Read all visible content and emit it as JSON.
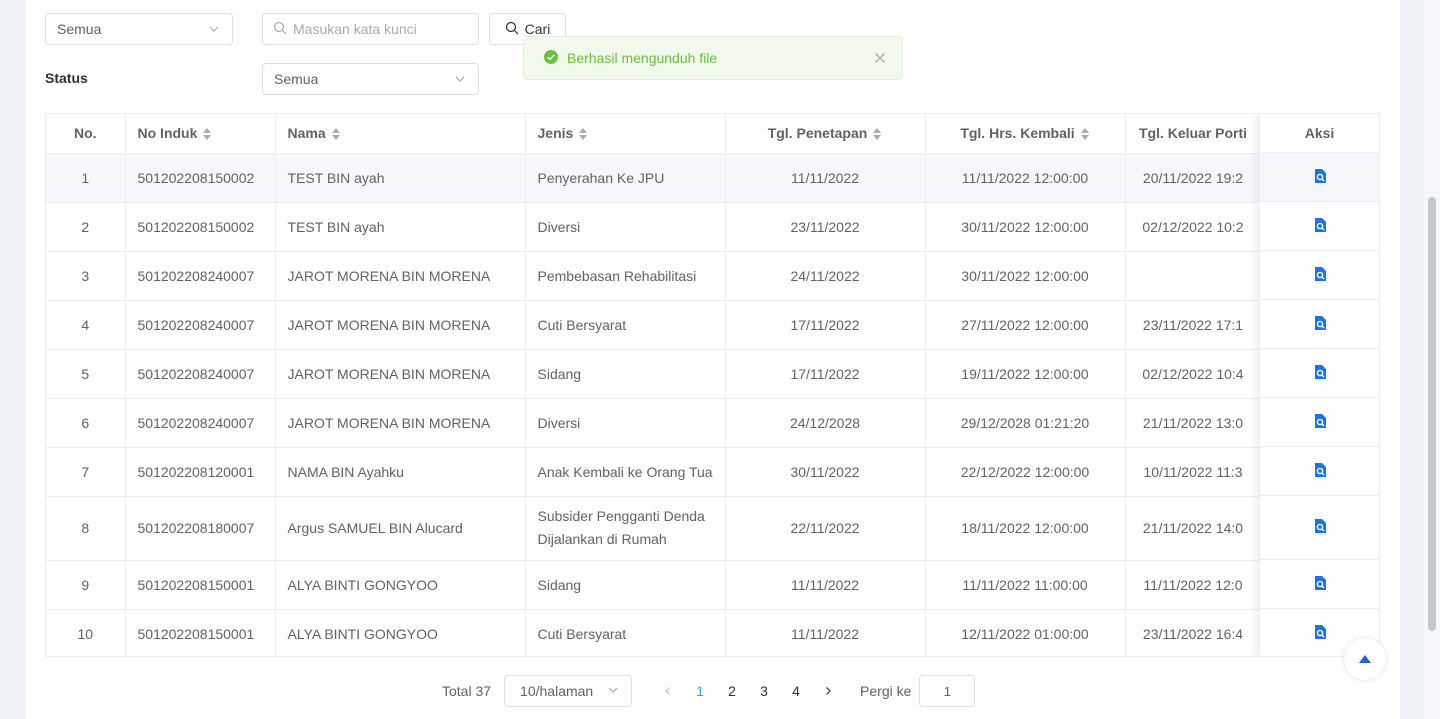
{
  "filters": {
    "category_select": "Semua",
    "search_placeholder": "Masukan kata kunci",
    "search_button": "Cari",
    "status_label": "Status",
    "status_select": "Semua"
  },
  "toast": {
    "message": "Berhasil mengunduh file"
  },
  "table": {
    "headers": {
      "no": "No.",
      "no_induk": "No Induk",
      "nama": "Nama",
      "jenis": "Jenis",
      "tgl_penetapan": "Tgl. Penetapan",
      "tgl_hrs_kembali": "Tgl. Hrs. Kembali",
      "tgl_keluar": "Tgl. Keluar Porti",
      "aksi": "Aksi"
    },
    "rows": [
      {
        "no": "1",
        "no_induk": "501202208150002",
        "nama": "TEST BIN ayah",
        "jenis": "Penyerahan Ke JPU",
        "tgl_penetapan": "11/11/2022",
        "tgl_hrs_kembali": "11/11/2022 12:00:00",
        "tgl_keluar": "20/11/2022 19:2"
      },
      {
        "no": "2",
        "no_induk": "501202208150002",
        "nama": "TEST BIN ayah",
        "jenis": "Diversi",
        "tgl_penetapan": "23/11/2022",
        "tgl_hrs_kembali": "30/11/2022 12:00:00",
        "tgl_keluar": "02/12/2022 10:2"
      },
      {
        "no": "3",
        "no_induk": "501202208240007",
        "nama": "JAROT MORENA BIN MORENA",
        "jenis": "Pembebasan Rehabilitasi",
        "tgl_penetapan": "24/11/2022",
        "tgl_hrs_kembali": "30/11/2022 12:00:00",
        "tgl_keluar": ""
      },
      {
        "no": "4",
        "no_induk": "501202208240007",
        "nama": "JAROT MORENA BIN MORENA",
        "jenis": "Cuti Bersyarat",
        "tgl_penetapan": "17/11/2022",
        "tgl_hrs_kembali": "27/11/2022 12:00:00",
        "tgl_keluar": "23/11/2022 17:1"
      },
      {
        "no": "5",
        "no_induk": "501202208240007",
        "nama": "JAROT MORENA BIN MORENA",
        "jenis": "Sidang",
        "tgl_penetapan": "17/11/2022",
        "tgl_hrs_kembali": "19/11/2022 12:00:00",
        "tgl_keluar": "02/12/2022 10:4"
      },
      {
        "no": "6",
        "no_induk": "501202208240007",
        "nama": "JAROT MORENA BIN MORENA",
        "jenis": "Diversi",
        "tgl_penetapan": "24/12/2028",
        "tgl_hrs_kembali": "29/12/2028 01:21:20",
        "tgl_keluar": "21/11/2022 13:0"
      },
      {
        "no": "7",
        "no_induk": "501202208120001",
        "nama": "NAMA BIN Ayahku",
        "jenis": "Anak Kembali ke Orang Tua",
        "tgl_penetapan": "30/11/2022",
        "tgl_hrs_kembali": "22/12/2022 12:00:00",
        "tgl_keluar": "10/11/2022 11:3"
      },
      {
        "no": "8",
        "no_induk": "501202208180007",
        "nama": "Argus SAMUEL BIN Alucard",
        "jenis": "Subsider Pengganti Denda Dijalankan di Rumah",
        "tgl_penetapan": "22/11/2022",
        "tgl_hrs_kembali": "18/11/2022 12:00:00",
        "tgl_keluar": "21/11/2022 14:0"
      },
      {
        "no": "9",
        "no_induk": "501202208150001",
        "nama": "ALYA BINTI GONGYOO",
        "jenis": "Sidang",
        "tgl_penetapan": "11/11/2022",
        "tgl_hrs_kembali": "11/11/2022 11:00:00",
        "tgl_keluar": "11/11/2022 12:0"
      },
      {
        "no": "10",
        "no_induk": "501202208150001",
        "nama": "ALYA BINTI GONGYOO",
        "jenis": "Cuti Bersyarat",
        "tgl_penetapan": "11/11/2022",
        "tgl_hrs_kembali": "12/11/2022 01:00:00",
        "tgl_keluar": "23/11/2022 16:4"
      }
    ],
    "action_icon": "view-document-icon"
  },
  "pagination": {
    "total": "Total 37",
    "page_size": "10/halaman",
    "pages": [
      "1",
      "2",
      "3",
      "4"
    ],
    "current_page": "1",
    "jump_label": "Pergi ke",
    "jump_value": "1"
  },
  "colors": {
    "accent": "#409eff",
    "success": "#67c23a",
    "action_icon": "#1a73e8"
  }
}
